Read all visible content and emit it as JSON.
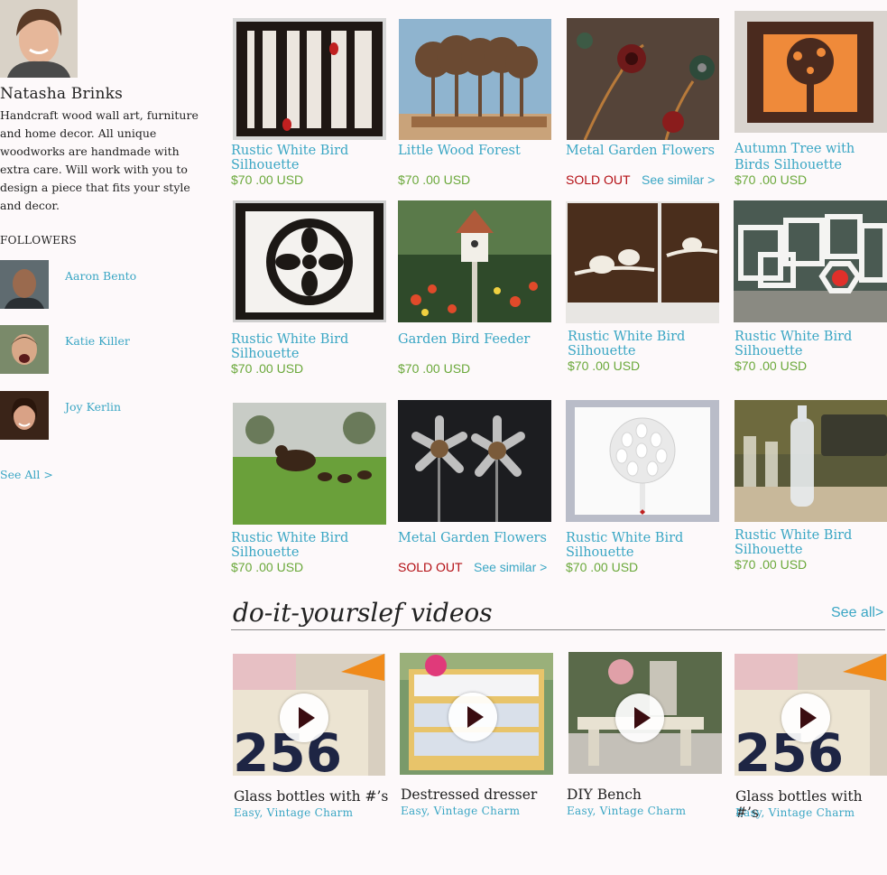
{
  "profile": {
    "name": "Natasha Brinks",
    "bio": "Handcraft wood wall art, furniture and home decor. All unique woodworks are handmade with extra care. Will work with you to design a piece that fits your style and decor.",
    "followers_heading": "FOLLOWERS",
    "followers": [
      {
        "name": "Aaron Bento"
      },
      {
        "name": "Katie Killer"
      },
      {
        "name": "Joy Kerlin"
      }
    ],
    "see_all": "See All >"
  },
  "products": [
    {
      "title": "Rustic White Bird Silhouette",
      "price": "$70 .00 USD"
    },
    {
      "title": "Little Wood Forest",
      "price": "$70 .00 USD"
    },
    {
      "title": "Metal Garden Flowers",
      "sold_out": "SOLD OUT",
      "similar": "See similar >"
    },
    {
      "title": "Autumn Tree with Birds Silhouette",
      "price": "$70 .00 USD"
    },
    {
      "title": "Rustic White Bird Silhouette",
      "price": "$70 .00 USD"
    },
    {
      "title": "Garden Bird Feeder",
      "price": "$70 .00 USD"
    },
    {
      "title": "Rustic White Bird Silhouette",
      "price": "$70 .00 USD"
    },
    {
      "title": "Rustic White Bird Silhouette",
      "price": "$70 .00 USD"
    },
    {
      "title": "Rustic White Bird Silhouette",
      "price": "$70 .00 USD"
    },
    {
      "title": "Metal Garden Flowers",
      "sold_out": "SOLD OUT",
      "similar": "See similar >"
    },
    {
      "title": "Rustic White Bird Silhouette",
      "price": "$70 .00 USD"
    },
    {
      "title": "Rustic White Bird Silhouette",
      "price": "$70 .00 USD"
    }
  ],
  "diy": {
    "heading": "do-it-yourslef videos",
    "see_all": "See all>",
    "videos": [
      {
        "title": "Glass bottles with #’s",
        "tags": "Easy, Vintage Charm"
      },
      {
        "title": "Destressed dresser",
        "tags": "Easy, Vintage Charm"
      },
      {
        "title": "DIY Bench",
        "tags": "Easy, Vintage Charm"
      },
      {
        "title": "Glass bottles with #’s",
        "tags": "Easy, Vintage Charm"
      }
    ]
  },
  "colors": {
    "link": "#3aa6c4",
    "price": "#6aa83a",
    "sold_out": "#b30d12",
    "background": "#fdf9fa"
  },
  "icons": [
    "play-icon"
  ]
}
